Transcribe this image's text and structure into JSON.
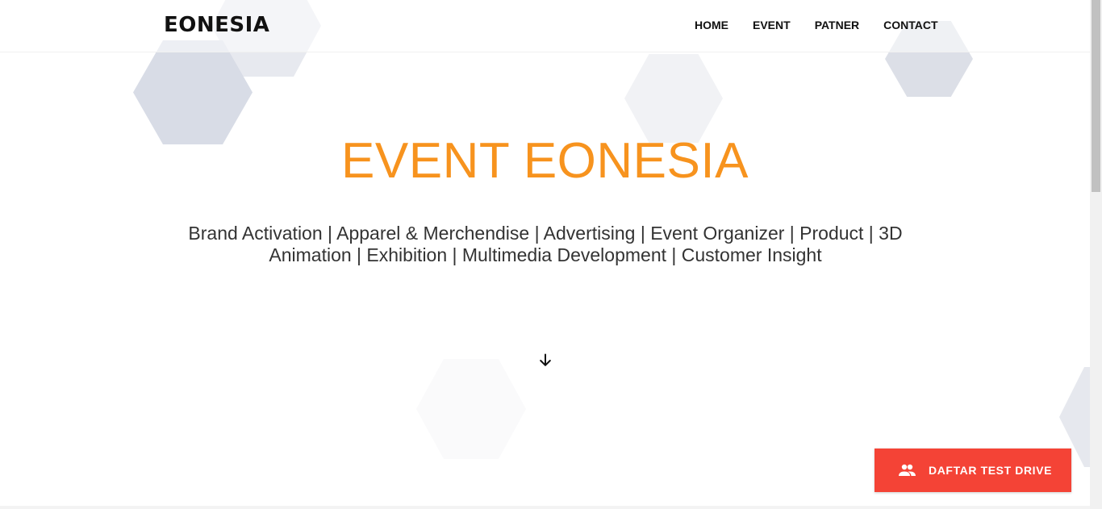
{
  "header": {
    "logo": "EONESIA",
    "nav": {
      "home": "HOME",
      "event": "EVENT",
      "partner": "PATNER",
      "contact": "CONTACT"
    }
  },
  "hero": {
    "title": "EVENT EONESIA",
    "subtitle": "Brand Activation | Apparel & Merchendise | Advertising | Event Organizer | Product | 3D Animation | Exhibition | Multimedia Development | Customer Insight",
    "scroll_icon": "arrow-down-icon"
  },
  "cta": {
    "label": "DAFTAR TEST DRIVE",
    "icon": "people-icon",
    "color": "#f44336"
  },
  "colors": {
    "accent": "#f7931e",
    "text": "#111111"
  }
}
